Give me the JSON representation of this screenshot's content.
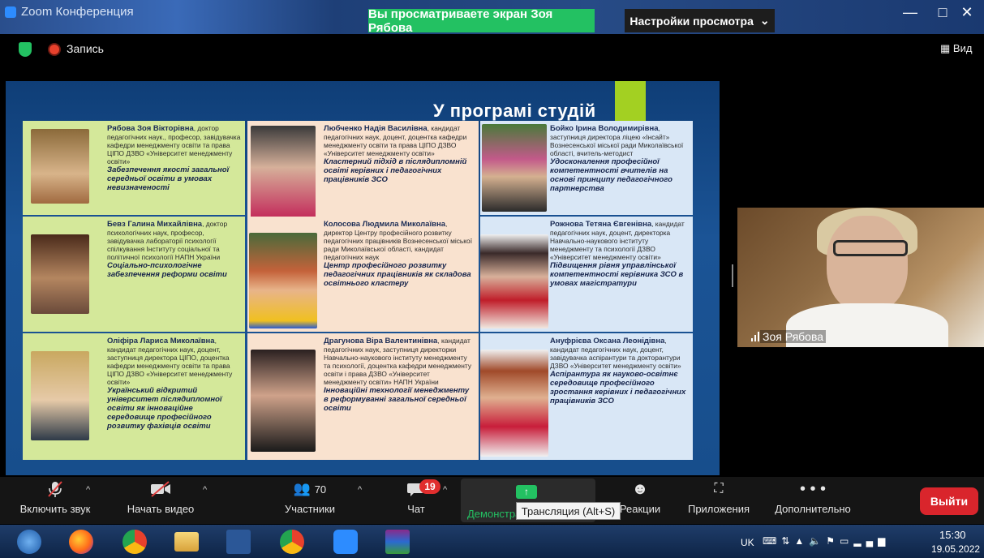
{
  "window": {
    "title": "Zoom Конференция",
    "share_banner": "Вы просматриваете экран Зоя Рябова",
    "view_settings": "Настройки просмотра",
    "minimize": "—",
    "maximize": "□",
    "close": "✕"
  },
  "topbar": {
    "record_label": "Запись",
    "view_label": "Вид"
  },
  "slide": {
    "title": "У програмі студій",
    "cards": [
      {
        "name": "Рябова Зоя Вікторівна",
        "bio": ", доктор педагогічних наук., професор, завідувачка кафедри менеджменту освіти та права ЦІПО ДЗВО «Університет менеджменту освіти»",
        "topic": "Забезпечення якості загальної середньої освіти в умовах невизначеності"
      },
      {
        "name": "Бевз Галина Михайлівна",
        "bio": ", доктор психологічних наук, професор, завідувачка лабораторії психології спілкування Інституту соціальної та політичної психології НАПН України",
        "topic": "Соціально-психологічне забезпечення реформи освіти"
      },
      {
        "name": "Оліфіра Лариса Миколаївна",
        "bio": ", кандидат педагогічних наук, доцент, заступниця директора ЦІПО, доцентка кафедри менеджменту освіти та права ЦІПО ДЗВО «Університет менеджменту освіти»",
        "topic": "Український відкритий університет післядипломної освіти як інноваційне середовище професійного розвитку фахівців освіти"
      },
      {
        "name": "Любченко Надія Василівна",
        "bio": ", кандидат педагогічних наук, доцент, доцентка кафедри менеджменту освіти та права ЦІПО ДЗВО «Університет менеджменту освіти»",
        "topic": "Кластерний підхід в післядипломній освіті керівних і педагогічних працівників ЗСО"
      },
      {
        "name": "Колосова Людмила Миколаївна",
        "bio": ", директор Центру професійного розвитку педагогічних працівників Вознесенської міської ради Миколаївської області, кандидат педагогічних наук",
        "topic": "Центр професійного розвитку педагогічних працівників як складова освітнього кластеру"
      },
      {
        "name": "Драгунова Віра Валентинівна",
        "bio": ", кандидат педагогічних наук, заступниця директорки Навчально-наукового інституту менеджменту та психології, доцентка кафедри менеджменту освіти і права ДЗВО «Університет менеджменту освіти» НАПН України",
        "topic": "Інноваційні технології менеджменту в реформуванні загальної середньої освіти"
      },
      {
        "name": "Бойко Ірина Володимирівна",
        "bio": ", заступниця директора ліцею «Інсайт» Вознесенської міської ради Миколаївської області, вчитель-методист",
        "topic": "Удосконалення професійної компетентності вчителів на основі принципу педагогічного партнерства"
      },
      {
        "name": "Рожнова Тетяна Євгенівна",
        "bio": ", кандидат педагогічних наук, доцент, директорка Навчально-наукового інституту менеджменту та психології ДЗВО «Університет менеджменту освіти»",
        "topic": "Підвищення рівня управлінської компетентності керівника ЗСО в умовах магістратури"
      },
      {
        "name": "Ануфрієва Оксана Леонідівна",
        "bio": ", кандидат педагогічних наук, доцент, завідувачка аспірантури та докторантури ДЗВО «Університет менеджменту освіти»",
        "topic": "Аспірантура як науково-освітнє середовище професійного зростання керівних і педагогічних працівників ЗСО"
      }
    ]
  },
  "video": {
    "participant_name": "Зоя Рябова"
  },
  "toolbar": {
    "unmute_label": "Включить звук",
    "start_video_label": "Начать видео",
    "participants_label": "Участники",
    "participants_count": "70",
    "chat_label": "Чат",
    "chat_badge": "19",
    "share_label": "Демонстрация экрана",
    "share_tooltip": "Трансляция (Alt+S)",
    "reactions_label": "Реакции",
    "apps_label": "Приложения",
    "more_label": "Дополнительно",
    "leave_label": "Выйти"
  },
  "taskbar": {
    "language": "UK",
    "time": "15:30",
    "date": "19.05.2022"
  },
  "colors": {
    "zoom_green": "#23c162",
    "leave_red": "#d9252c",
    "slide_blue": "#174e8c",
    "card_green": "#d4e89a",
    "card_peach": "#f9e2cf",
    "card_blue": "#d9e7f6"
  }
}
